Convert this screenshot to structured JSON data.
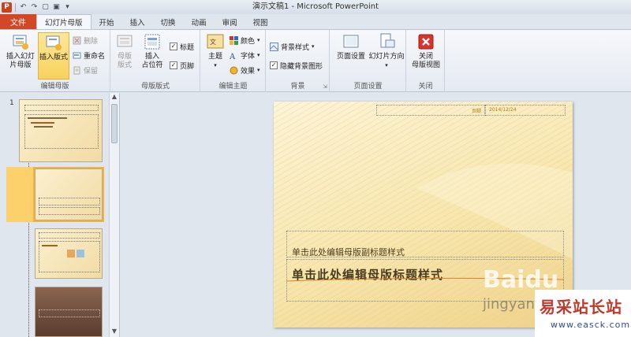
{
  "window": {
    "title": "演示文稿1 - Microsoft PowerPoint",
    "app_icon": "P",
    "quick_access": [
      "undo-icon",
      "redo-icon",
      "new-icon",
      "save-icon",
      "customize-icon"
    ]
  },
  "tabs": {
    "file": "文件",
    "items": [
      {
        "label": "幻灯片母版",
        "active": true
      },
      {
        "label": "开始",
        "active": false
      },
      {
        "label": "插入",
        "active": false
      },
      {
        "label": "切换",
        "active": false
      },
      {
        "label": "动画",
        "active": false
      },
      {
        "label": "审阅",
        "active": false
      },
      {
        "label": "视图",
        "active": false
      }
    ]
  },
  "ribbon": {
    "edit_master": {
      "label": "编辑母版",
      "insert_slide_master": "插入幻灯\n片母版",
      "insert_layout": "插入版式",
      "delete": "删除",
      "rename": "重命名",
      "preserve": "保留"
    },
    "master_layout": {
      "label": "母版版式",
      "master_layout_btn": "母版\n版式",
      "insert_placeholder": "插入\n占位符",
      "title_check": "标题",
      "footer_check": "页脚"
    },
    "edit_theme": {
      "label": "编辑主题",
      "themes": "主题",
      "colors": "颜色",
      "fonts": "字体",
      "effects": "效果"
    },
    "background": {
      "label": "背景",
      "background_styles": "背景样式",
      "hide_background": "隐藏背景图形"
    },
    "page_setup": {
      "label": "页面设置",
      "page_setup_btn": "页面设置",
      "orientation": "幻灯片方向"
    },
    "close": {
      "label": "关闭",
      "close_master": "关闭\n母版视图"
    }
  },
  "thumbnails": {
    "first_number": "1"
  },
  "slide": {
    "footer_text": "页脚",
    "date_text": "2014/12/24",
    "subtitle": "单击此处编辑母版副标题样式",
    "title": "单击此处编辑母版标题样式"
  },
  "watermarks": {
    "baidu": "Baidu",
    "jingyan": "jingyan",
    "site_cn": "易采站长站",
    "site_en": "www.easck.com"
  },
  "colors": {
    "file_tab": "#d24726",
    "selection": "#fcd06a",
    "slide_bg": "#f7e6ad"
  }
}
